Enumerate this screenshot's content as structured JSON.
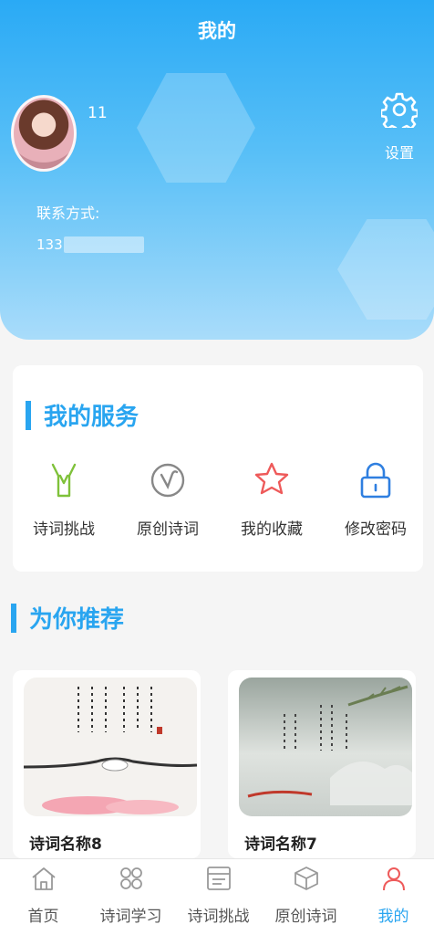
{
  "header": {
    "title": "我的",
    "username": "11",
    "settings_label": "设置",
    "contact_label": "联系方式:",
    "phone_prefix": "133"
  },
  "services": {
    "title": "我的服务",
    "items": [
      {
        "label": "诗词挑战",
        "icon": "mortar-board-icon",
        "color": "#7fc13a"
      },
      {
        "label": "原创诗词",
        "icon": "pen-circle-icon",
        "color": "#888888"
      },
      {
        "label": "我的收藏",
        "icon": "star-icon",
        "color": "#ee5a5a"
      },
      {
        "label": "修改密码",
        "icon": "lock-icon",
        "color": "#2f7fe0"
      }
    ]
  },
  "recommend": {
    "title": "为你推荐",
    "items": [
      {
        "name": "诗词名称8"
      },
      {
        "name": "诗词名称7"
      }
    ]
  },
  "tabbar": {
    "items": [
      {
        "label": "首页",
        "icon": "home-icon",
        "active": false
      },
      {
        "label": "诗词学习",
        "icon": "grid-icon",
        "active": false
      },
      {
        "label": "诗词挑战",
        "icon": "board-icon",
        "active": false
      },
      {
        "label": "原创诗词",
        "icon": "box-icon",
        "active": false
      },
      {
        "label": "我的",
        "icon": "user-icon",
        "active": true
      }
    ]
  },
  "colors": {
    "accent": "#29a5f0",
    "active_tab": "#29a5f0"
  }
}
